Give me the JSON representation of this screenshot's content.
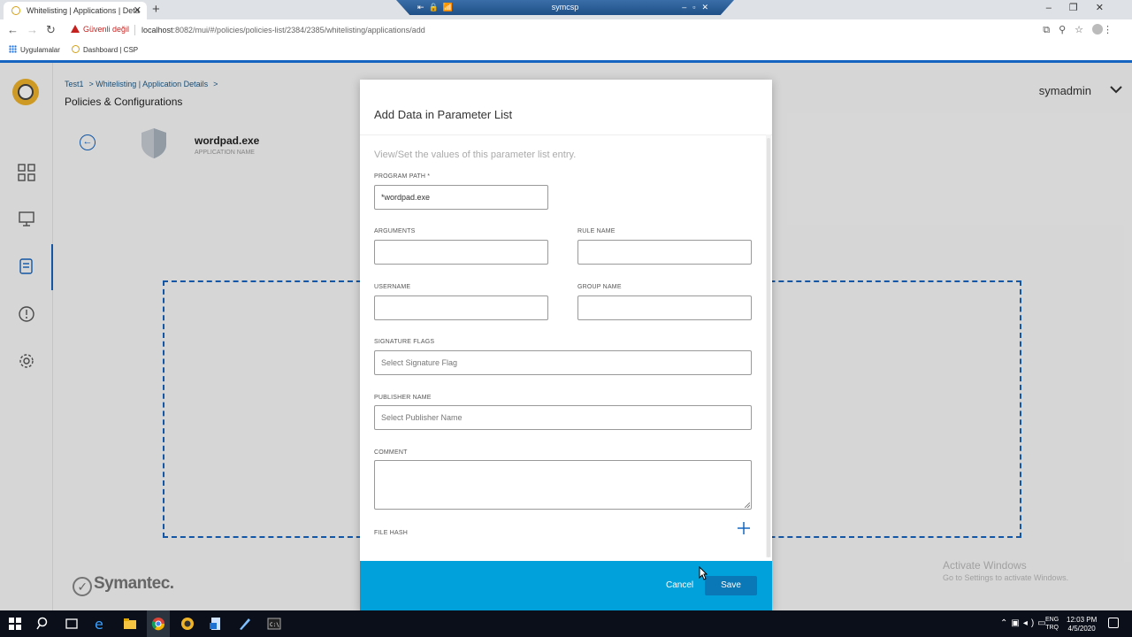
{
  "browser": {
    "tab_title": "Whitelisting | Applications | Deta",
    "remote_title": "symcsp",
    "security_label": "Güvenli değil",
    "url_host": "localhost",
    "url_rest": ":8082/mui/#/policies/policies-list/2384/2385/whitelisting/applications/add",
    "bookmarks": [
      "Uygulamalar",
      "Dashboard | CSP"
    ]
  },
  "header": {
    "breadcrumb": [
      "Test1",
      "> Whitelisting | Application Details",
      ">"
    ],
    "title": "Policies & Configurations",
    "user": "symadmin"
  },
  "application": {
    "name": "wordpad.exe",
    "name_label": "APPLICATION NAME"
  },
  "modal": {
    "title": "Add Data in Parameter List",
    "description": "View/Set the values of this parameter list entry.",
    "fields": {
      "program_path": {
        "label": "PROGRAM PATH *",
        "value": "*wordpad.exe"
      },
      "arguments": {
        "label": "ARGUMENTS",
        "value": ""
      },
      "rule_name": {
        "label": "RULE NAME",
        "value": ""
      },
      "username": {
        "label": "USERNAME",
        "value": ""
      },
      "group_name": {
        "label": "GROUP NAME",
        "value": ""
      },
      "signature_flags": {
        "label": "SIGNATURE FLAGS",
        "placeholder": "Select Signature Flag"
      },
      "publisher_name": {
        "label": "PUBLISHER NAME",
        "placeholder": "Select Publisher Name"
      },
      "comment": {
        "label": "COMMENT",
        "value": ""
      },
      "file_hash": {
        "label": "FILE HASH"
      }
    },
    "cancel_label": "Cancel",
    "save_label": "Save"
  },
  "brand": "Symantec.",
  "watermark": {
    "line1": "Activate Windows",
    "line2": "Go to Settings to activate Windows."
  },
  "taskbar": {
    "lang": [
      "ENG",
      "TRQ"
    ],
    "time": "12:03 PM",
    "date": "4/5/2020"
  },
  "colors": {
    "accent": "#1565c0",
    "modal_footer": "#01a2dc",
    "save_button": "#0a78b7"
  }
}
